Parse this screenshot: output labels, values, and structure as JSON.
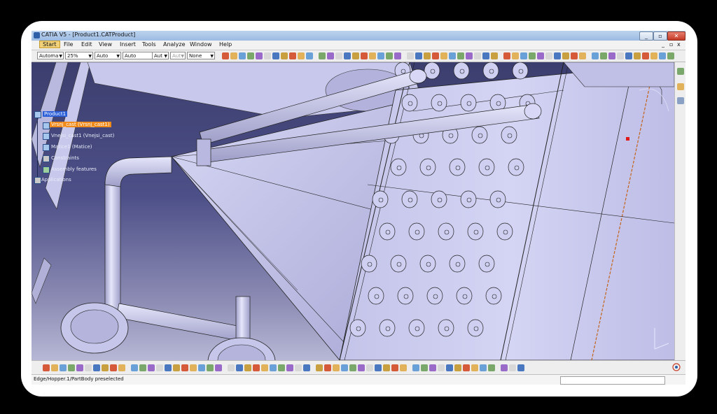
{
  "window": {
    "title": "CATIA V5 - [Product1.CATProduct]",
    "controls": [
      "_",
      "▫",
      "✕"
    ],
    "doc_controls": [
      "_",
      "▫",
      "x"
    ]
  },
  "menu": {
    "items": [
      "Start",
      "File",
      "Edit",
      "View",
      "Insert",
      "Tools",
      "Analyze",
      "Window",
      "Help"
    ]
  },
  "toolbar": {
    "combos": [
      "Automa",
      "25%",
      "Auto",
      "Auto",
      "Aut",
      "Aut",
      "None"
    ]
  },
  "tree": {
    "nodes": [
      "Product1",
      "Vrsnj_cast (Vrsnj_cast1)",
      "Vnejsi_cast1 (Vnejsi_cast)",
      "Matice1 (Matice)",
      "Constraints",
      "Assembly features",
      "Applications"
    ]
  },
  "status": {
    "message": "Edge/Hopper.1/PartBody preselected"
  },
  "colors": {
    "background": "#000000",
    "viewport_top": "#3c3e6e",
    "viewport_bottom": "#b7b8d6",
    "part": "#c9c9ee",
    "tree_selected": "#2a5ed8",
    "tree_highlight": "#f08a1a"
  },
  "icons": {
    "compass": "compass-icon",
    "axis": "axis-triad-icon",
    "catia_logo": "catia-logo-icon"
  }
}
